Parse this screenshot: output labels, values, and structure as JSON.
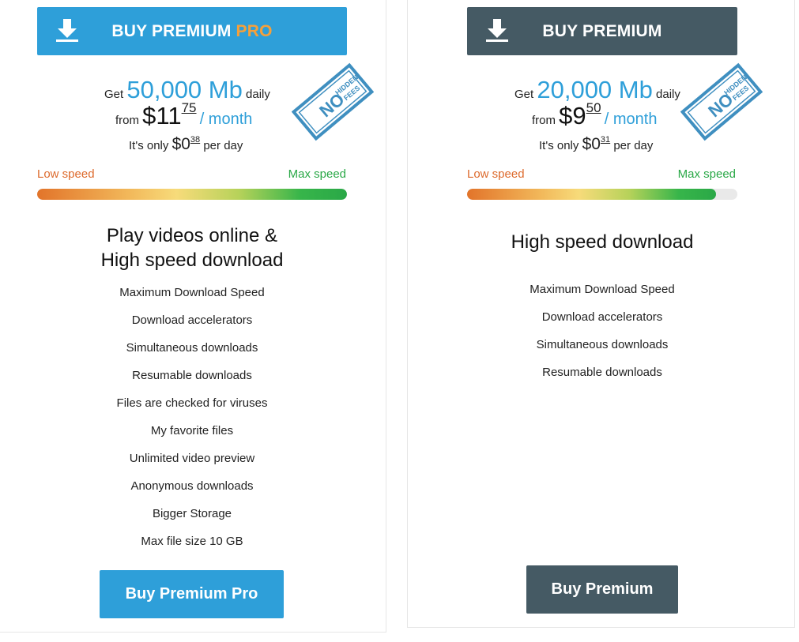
{
  "colors": {
    "pro_accent": "#2e9fd9",
    "std_accent": "#455a64",
    "pro_label_accent": "#f5a03b",
    "low_speed": "#dd6a2c",
    "max_speed": "#2aa847"
  },
  "plans": {
    "pro": {
      "top_button_main": "BUY PREMIUM",
      "top_button_accent": "PRO",
      "get_label": "Get",
      "daily_amount": "50,000 Mb",
      "daily_label": "daily",
      "from_label": "from",
      "price_whole": "$11",
      "price_cents": "75",
      "per_month": "/ month",
      "only_label": "It's only",
      "day_price_whole": "$0",
      "day_price_cents": "38",
      "per_day": "per day",
      "stamp_top": "NO",
      "stamp_mid": "HIDDEN",
      "stamp_bottom": "FEES",
      "speed_low": "Low speed",
      "speed_max": "Max speed",
      "speed_level": 1.0,
      "heading_line1": "Play videos online &",
      "heading_line2": "High speed download",
      "features": [
        "Maximum Download Speed",
        "Download accelerators",
        "Simultaneous downloads",
        "Resumable downloads",
        "Files are checked for viruses",
        "My favorite files",
        "Unlimited video preview",
        "Anonymous downloads",
        "Bigger Storage",
        "Max file size 10 GB"
      ],
      "bottom_button": "Buy Premium Pro"
    },
    "std": {
      "top_button_main": "BUY PREMIUM",
      "get_label": "Get",
      "daily_amount": "20,000 Mb",
      "daily_label": "daily",
      "from_label": "from",
      "price_whole": "$9",
      "price_cents": "50",
      "per_month": "/ month",
      "only_label": "It's only",
      "day_price_whole": "$0",
      "day_price_cents": "31",
      "per_day": "per day",
      "stamp_top": "NO",
      "stamp_mid": "HIDDEN",
      "stamp_bottom": "FEES",
      "speed_low": "Low speed",
      "speed_max": "Max speed",
      "speed_level": 0.92,
      "heading_line1": "High speed download",
      "features": [
        "Maximum Download Speed",
        "Download accelerators",
        "Simultaneous downloads",
        "Resumable downloads"
      ],
      "bottom_button": "Buy Premium"
    }
  }
}
